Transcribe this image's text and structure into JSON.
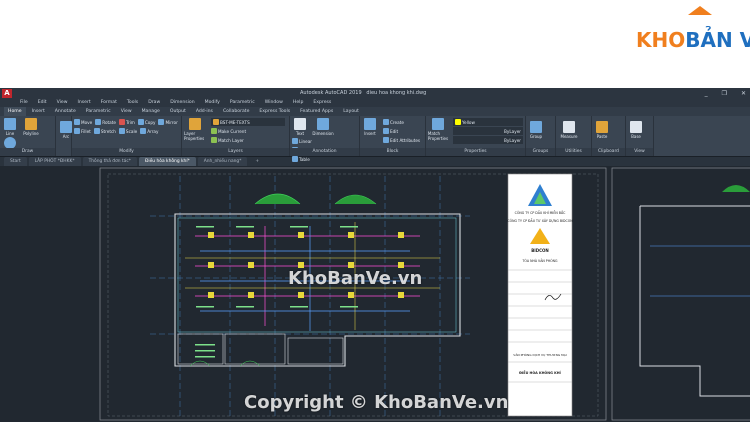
{
  "logo": {
    "part1": "KHO",
    "part2": "BẢN VẼ"
  },
  "window": {
    "app_name": "Autodesk AutoCAD 2019",
    "file_name": "dieu hoa khong khi.dwg",
    "app_letter": "A",
    "controls": [
      "_",
      "❐",
      "✕"
    ]
  },
  "menu": [
    "File",
    "Edit",
    "View",
    "Insert",
    "Format",
    "Tools",
    "Draw",
    "Dimension",
    "Modify",
    "Parametric",
    "Window",
    "Help",
    "Express"
  ],
  "ribbon_tabs": [
    "Home",
    "Insert",
    "Annotate",
    "Parametric",
    "View",
    "Manage",
    "Output",
    "Add-ins",
    "Collaborate",
    "Express Tools",
    "Featured Apps",
    "Layout"
  ],
  "ribbon_active_tab": "Home",
  "panels": {
    "draw": {
      "label": "Draw",
      "tools": [
        "Line",
        "Polyline",
        "Circle",
        "Arc"
      ]
    },
    "modify": {
      "label": "Modify",
      "tools": [
        "Move",
        "Rotate",
        "Trim",
        "Copy",
        "Mirror",
        "Fillet",
        "Stretch",
        "Scale",
        "Array"
      ]
    },
    "layers": {
      "label": "Layers",
      "big": "Layer Properties",
      "current_layer": "BST-ME-TEXTS",
      "tools": [
        "Make Current",
        "Match Layer"
      ]
    },
    "annotation": {
      "label": "Annotation",
      "big": [
        "Text",
        "Dimension"
      ],
      "tools": [
        "Linear",
        "Leader",
        "Table"
      ]
    },
    "block": {
      "label": "Block",
      "big": "Insert",
      "tools": [
        "Create",
        "Edit",
        "Edit Attributes"
      ]
    },
    "properties": {
      "label": "Properties",
      "big": "Match Properties",
      "color": "Yellow",
      "linetype": "ByLayer",
      "lineweight": "ByLayer"
    },
    "groups": {
      "label": "Groups",
      "big": "Group"
    },
    "utilities": {
      "label": "Utilities",
      "big": "Measure"
    },
    "clipboard": {
      "label": "Clipboard",
      "big": "Paste"
    },
    "view": {
      "label": "View",
      "big": "Base"
    }
  },
  "doc_tabs": [
    "Start",
    "LẮP PHÓT *ĐHKK*",
    "Thông thả đơn tác*",
    "Điều hòa không khí*",
    "Anh_nhiều nang*"
  ],
  "doc_active_tab": "Điều hòa không khí*",
  "title_block": {
    "company1": "CÔNG TY CP DẦU KHÍ MIỀN BẮC",
    "company2": "CÔNG TY CP ĐẦU TƯ XÂY DỰNG BIDCON",
    "project_type": "TÒA NHÀ VĂN PHÒNG",
    "drawing_name": "VĂN PHÒNG DỊCH VỤ THƯƠNG MẠI",
    "sheet_title": "ĐIỀU HÒA KHÔNG KHÍ",
    "logo2": "BIDCON"
  },
  "watermarks": [
    "KhoBanVe.vn",
    "Copyright © KhoBanVe.vn"
  ],
  "colors": {
    "accent": "#f07f1e",
    "brand_blue": "#1f6fbf",
    "canvas": "#212830",
    "ribbon": "#3a4552"
  }
}
